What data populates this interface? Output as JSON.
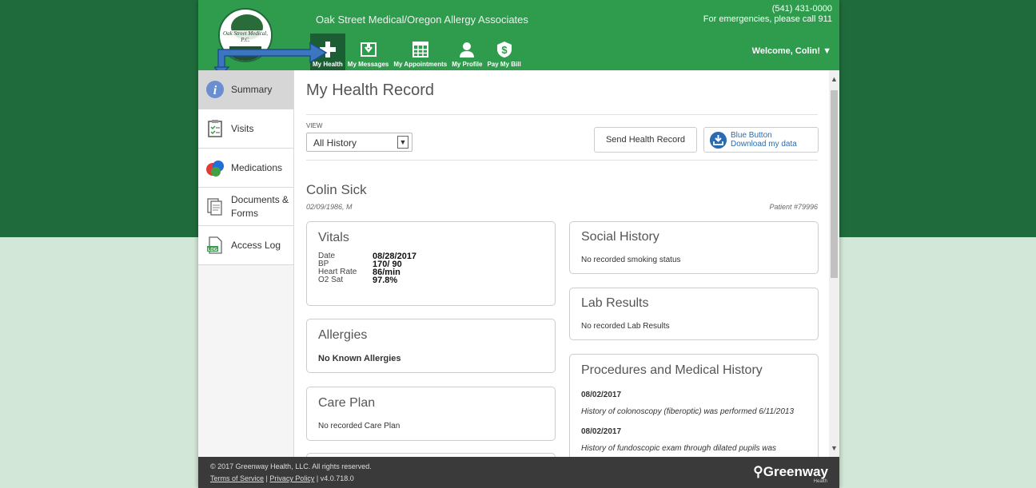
{
  "header": {
    "logo_text": "Oak Street Medical, P.C.",
    "clinic_name": "Oak Street Medical/Oregon Allergy Associates",
    "phone": "(541) 431-0000",
    "emergency": "For emergencies, please call 911",
    "welcome": "Welcome, Colin!",
    "nav": [
      {
        "label": "My Health",
        "icon": "plus-icon"
      },
      {
        "label": "My Messages",
        "icon": "inbox-icon"
      },
      {
        "label": "My Appointments",
        "icon": "calendar-grid-icon"
      },
      {
        "label": "My Profile",
        "icon": "person-icon"
      },
      {
        "label": "Pay My Bill",
        "icon": "dollar-icon"
      }
    ]
  },
  "sidebar": {
    "items": [
      {
        "label": "Summary",
        "icon": "info-icon"
      },
      {
        "label": "Visits",
        "icon": "clipboard-icon"
      },
      {
        "label": "Medications",
        "icon": "pills-icon"
      },
      {
        "label": "Documents &",
        "label2": "Forms",
        "icon": "documents-icon"
      },
      {
        "label": "Access Log",
        "icon": "log-file-icon"
      }
    ]
  },
  "main": {
    "title": "My Health Record",
    "view_label": "VIEW",
    "view_value": "All History",
    "send_button": "Send Health Record",
    "blue_button_line1": "Blue Button",
    "blue_button_line2": "Download my data",
    "patient_name": "Colin Sick",
    "patient_dob": "02/09/1986, M",
    "patient_number": "Patient #79996"
  },
  "cards": {
    "vitals": {
      "title": "Vitals",
      "rows": [
        {
          "label": "Date",
          "value": "08/28/2017"
        },
        {
          "label": "BP",
          "value": "170/ 90"
        },
        {
          "label": "Heart Rate",
          "value": "86/min"
        },
        {
          "label": "O2 Sat",
          "value": "97.8%"
        }
      ]
    },
    "allergies": {
      "title": "Allergies",
      "text": "No Known Allergies"
    },
    "care_plan": {
      "title": "Care Plan",
      "text": "No recorded Care Plan"
    },
    "social_history": {
      "title": "Social History",
      "text": "No recorded smoking status"
    },
    "lab_results": {
      "title": "Lab Results",
      "text": "No recorded Lab Results"
    },
    "procedures": {
      "title": "Procedures and Medical History",
      "entries": [
        {
          "date": "08/02/2017",
          "text": "History of colonoscopy (fiberoptic) was performed 6/11/2013"
        },
        {
          "date": "08/02/2017",
          "text": "History of fundoscopic exam through dilated pupils was"
        }
      ]
    }
  },
  "footer": {
    "copyright": "© 2017 Greenway Health, LLC. All rights reserved.",
    "terms": "Terms of Service",
    "privacy": "Privacy Policy",
    "version": "v4.0.718.0",
    "brand": "Greenway",
    "brand_sub": "Health"
  },
  "colors": {
    "outer_band": "#1f6b3b",
    "header_green": "#2e9b4d",
    "active_nav": "#1c5e33",
    "footer": "#3a3a3a",
    "link_blue": "#2b6cb0"
  }
}
